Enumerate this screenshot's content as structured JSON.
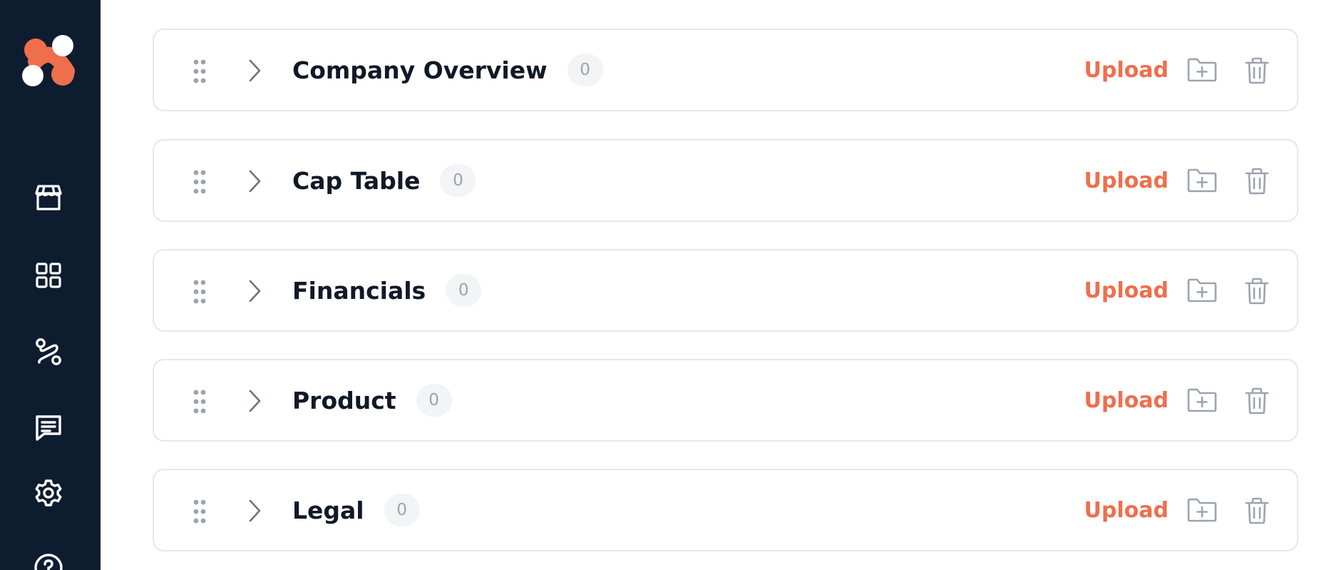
{
  "sidebar": {
    "logo": "app-logo",
    "nav_items": [
      {
        "icon": "storefront-icon"
      },
      {
        "icon": "dashboard-grid-icon"
      },
      {
        "icon": "route-icon"
      },
      {
        "icon": "message-icon"
      },
      {
        "icon": "gear-icon"
      },
      {
        "icon": "help-icon"
      }
    ]
  },
  "colors": {
    "sidebar_bg": "#0e1c30",
    "accent": "#ef6e4c",
    "icon_gray": "#9ca3af",
    "border": "#e5e7eb",
    "text": "#111827"
  },
  "folders": [
    {
      "name": "Company Overview",
      "count": "0",
      "upload_label": "Upload"
    },
    {
      "name": "Cap Table",
      "count": "0",
      "upload_label": "Upload"
    },
    {
      "name": "Financials",
      "count": "0",
      "upload_label": "Upload"
    },
    {
      "name": "Product",
      "count": "0",
      "upload_label": "Upload"
    },
    {
      "name": "Legal",
      "count": "0",
      "upload_label": "Upload"
    }
  ]
}
